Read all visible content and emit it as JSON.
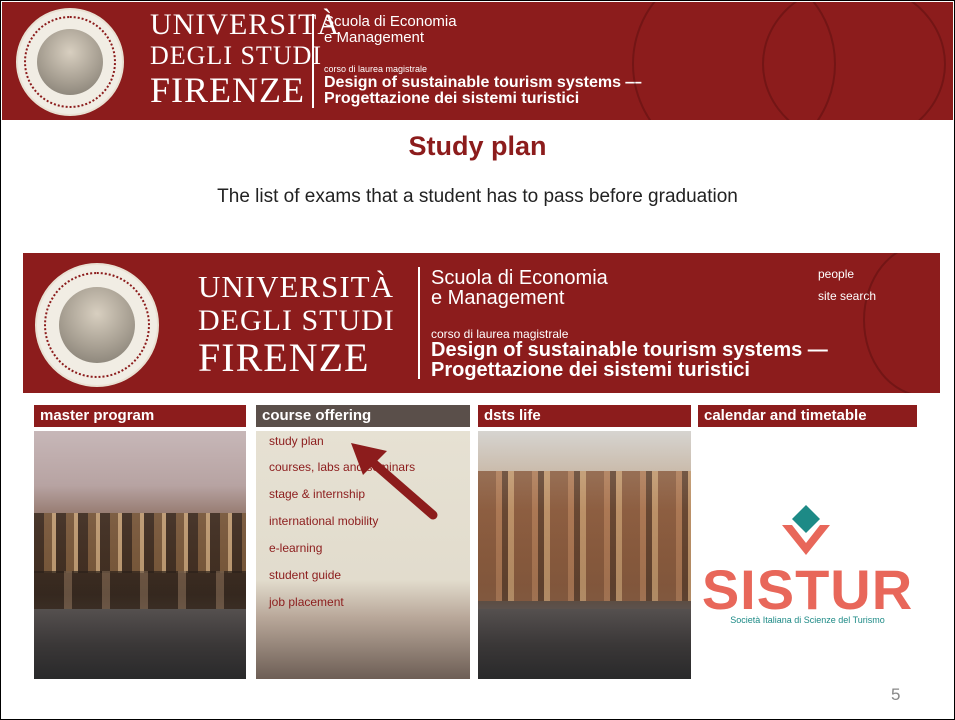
{
  "banner": {
    "uni_line1": "UNIVERSITÀ",
    "uni_line2": "DEGLI STUDI",
    "uni_line3": "FIRENZE",
    "school_line1": "Scuola di Economia",
    "school_line2": "e Management",
    "course_label": "corso di laurea magistrale",
    "course_title1": "Design of sustainable tourism systems —",
    "course_title2": "Progettazione dei sistemi turistici",
    "seal_text": "FLORENTINA STUDIORUM UNIVERSITAS"
  },
  "slide": {
    "title": "Study plan",
    "subtitle": "The list of exams that a student has to pass before graduation",
    "page_number": "5"
  },
  "site": {
    "uni_line1": "UNIVERSITÀ",
    "uni_line2": "DEGLI STUDI",
    "uni_line3": "FIRENZE",
    "school_line1": "Scuola di Economia",
    "school_line2": "e Management",
    "course_label": "corso di laurea magistrale",
    "course_title1": "Design of sustainable tourism systems —",
    "course_title2": "Progettazione dei sistemi turistici",
    "link_people": "people",
    "link_search": "site search",
    "nav": [
      "master program",
      "course offering",
      "dsts life",
      "calendar and timetable"
    ],
    "menu": [
      "study plan",
      "courses, labs and seminars",
      "stage & internship",
      "international mobility",
      "e-learning",
      "student guide",
      "job placement"
    ],
    "sistur_name": "SISTUR",
    "sistur_sub": "Società Italiana di Scienze del Turismo"
  },
  "colors": {
    "brand_red": "#8c1c1c",
    "arrow": "#8c1c1c",
    "sistur_red": "#e8675a",
    "sistur_teal": "#1d8a86"
  }
}
